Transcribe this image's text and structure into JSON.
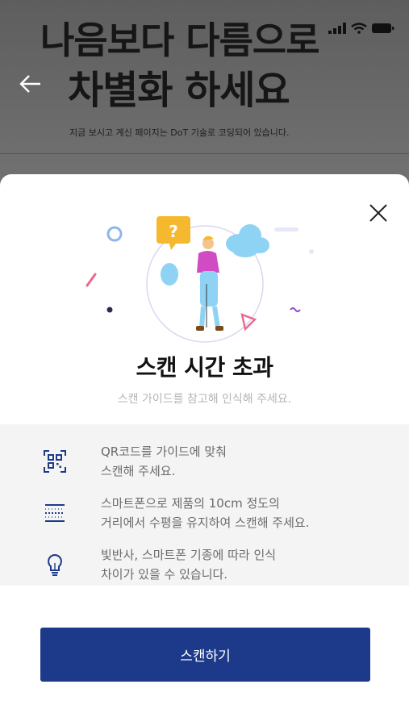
{
  "background": {
    "headline_line1": "나음보다 다름으로",
    "headline_line2": "차별화 하세요",
    "caption": "지금 보시고 계신 페이지는 DoT 기술로 코딩되어 있습니다."
  },
  "icons": {
    "back": "arrow-left-icon",
    "close": "close-icon",
    "qr": "qr-scan-icon",
    "distance": "distance-icon",
    "light": "lightbulb-icon"
  },
  "modal": {
    "title": "스캔 시간 초과",
    "subtitle": "스캔 가이드를 참고해 인식해 주세요.",
    "guides": [
      {
        "line1": "QR코드를 가이드에 맞춰",
        "line2": "스캔해 주세요."
      },
      {
        "line1": "스마트폰으로 제품의 10cm 정도의",
        "line2": "거리에서 수평을 유지하여 스캔해 주세요."
      },
      {
        "line1": "빛반사, 스마트폰 기종에 따라 인식",
        "line2": "차이가 있을 수 있습니다."
      }
    ],
    "button_label": "스캔하기"
  },
  "colors": {
    "primary": "#1d3a8a",
    "accent_blue": "#8fd3f4",
    "accent_pink": "#d14cc2",
    "accent_yellow": "#f5b82e"
  }
}
